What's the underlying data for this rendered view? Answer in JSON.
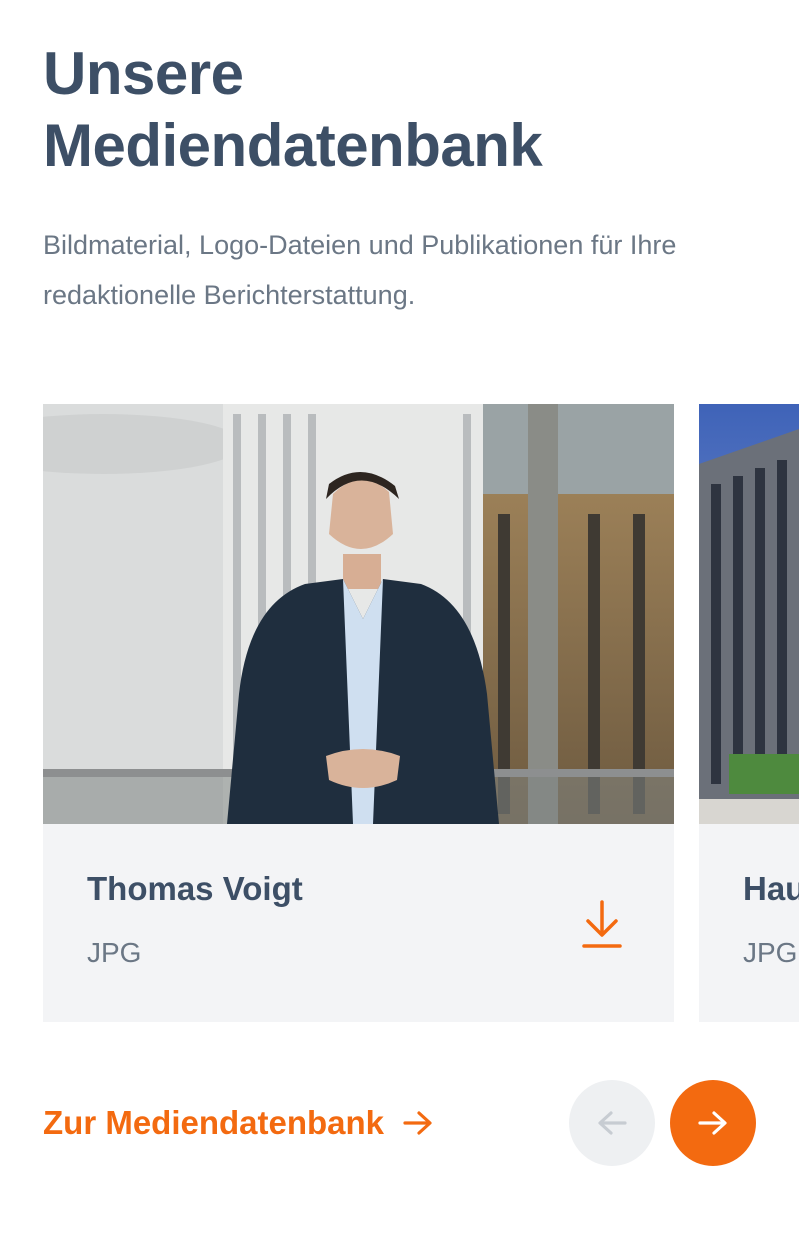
{
  "header": {
    "title_line1": "Unsere",
    "title_line2": "Mediendatenbank",
    "intro": "Bildmaterial, Logo-Dateien und Publikationen für Ihre redaktionelle Berichterstattung."
  },
  "carousel": {
    "cards": [
      {
        "title": "Thomas Voigt",
        "type": "JPG",
        "image": "portrait-photo",
        "action_icon": "download-icon"
      },
      {
        "title": "Hau",
        "type": "JPG",
        "image": "building-photo"
      }
    ]
  },
  "footer": {
    "link_label": "Zur Mediendatenbank",
    "link_icon": "arrow-right-icon",
    "prev_icon": "arrow-left-icon",
    "next_icon": "arrow-right-icon"
  },
  "colors": {
    "accent": "#f36a10",
    "heading": "#3d4f66",
    "body_text": "#6b7785",
    "card_bg": "#f3f4f6",
    "prev_button_bg": "#eef0f2"
  }
}
